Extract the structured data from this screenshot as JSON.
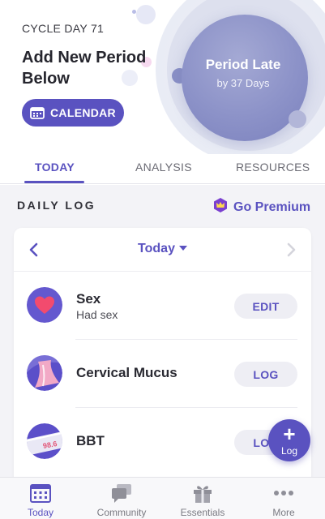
{
  "header": {
    "cycle_day": "CYCLE DAY 71",
    "headline": "Add New Period Below",
    "calendar_button": "CALENDAR",
    "status_title": "Period Late",
    "status_subtitle": "by 37 Days"
  },
  "tabs": [
    {
      "label": "TODAY",
      "active": true
    },
    {
      "label": "ANALYSIS",
      "active": false
    },
    {
      "label": "RESOURCES",
      "active": false
    }
  ],
  "daily_log": {
    "title": "DAILY LOG",
    "premium_label": "Go Premium",
    "day_selector": "Today",
    "rows": [
      {
        "title": "Sex",
        "subtitle": "Had sex",
        "action": "EDIT",
        "icon": "heart-icon"
      },
      {
        "title": "Cervical Mucus",
        "subtitle": "",
        "action": "LOG",
        "icon": "cervical-mucus-icon"
      },
      {
        "title": "BBT",
        "subtitle": "",
        "action": "LOG",
        "icon": "thermometer-icon",
        "icon_text": "98.6"
      }
    ]
  },
  "fab": {
    "label": "Log",
    "symbol": "+"
  },
  "bottom_nav": [
    {
      "label": "Today",
      "icon": "calendar-icon",
      "active": true
    },
    {
      "label": "Community",
      "icon": "chat-bubbles-icon",
      "active": false
    },
    {
      "label": "Essentials",
      "icon": "gift-icon",
      "active": false
    },
    {
      "label": "More",
      "icon": "more-dots-icon",
      "active": false
    }
  ],
  "colors": {
    "accent": "#5a52c0",
    "status_circle": "#8c92c8",
    "premium_crown": "#7a3fd0"
  }
}
